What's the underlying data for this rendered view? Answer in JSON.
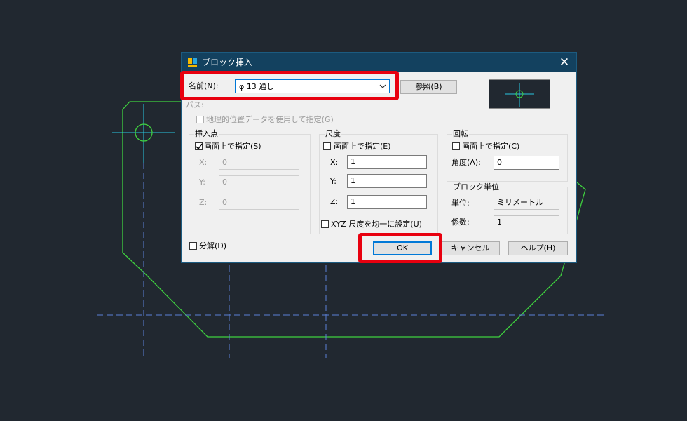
{
  "dialog": {
    "title": "ブロック挿入",
    "close_glyph": "✕",
    "name_label": "名前(N):",
    "name_value": "φ 13 通し",
    "browse_label": "参照(B)",
    "path_label": "パス:",
    "geo_label": "地理的位置データを使用して指定(G)",
    "insertion": {
      "title": "挿入点",
      "onscreen_label": "画面上で指定(S)",
      "onscreen_checked": true,
      "x_label": "X:",
      "x_value": "0",
      "y_label": "Y:",
      "y_value": "0",
      "z_label": "Z:",
      "z_value": "0"
    },
    "scale": {
      "title": "尺度",
      "onscreen_label": "画面上で指定(E)",
      "onscreen_checked": false,
      "x_label": "X:",
      "x_value": "1",
      "y_label": "Y:",
      "y_value": "1",
      "z_label": "Z:",
      "z_value": "1",
      "uniform_label": "XYZ 尺度を均一に設定(U)",
      "uniform_checked": false
    },
    "rotation": {
      "title": "回転",
      "onscreen_label": "画面上で指定(C)",
      "onscreen_checked": false,
      "angle_label": "角度(A):",
      "angle_value": "0"
    },
    "units": {
      "title": "ブロック単位",
      "unit_label": "単位:",
      "unit_value": "ミリメートル",
      "factor_label": "係数:",
      "factor_value": "1"
    },
    "explode_label": "分解(D)",
    "explode_checked": false,
    "ok_label": "OK",
    "cancel_label": "キャンセル",
    "help_label": "ヘルプ(H)"
  },
  "colors": {
    "canvas_bg": "#212830",
    "drawing_line": "#3fd13f",
    "center_line": "#5b7fd6",
    "crosshair": "#29c6e0",
    "highlight": "#e8000f",
    "titlebar": "#13415f"
  }
}
